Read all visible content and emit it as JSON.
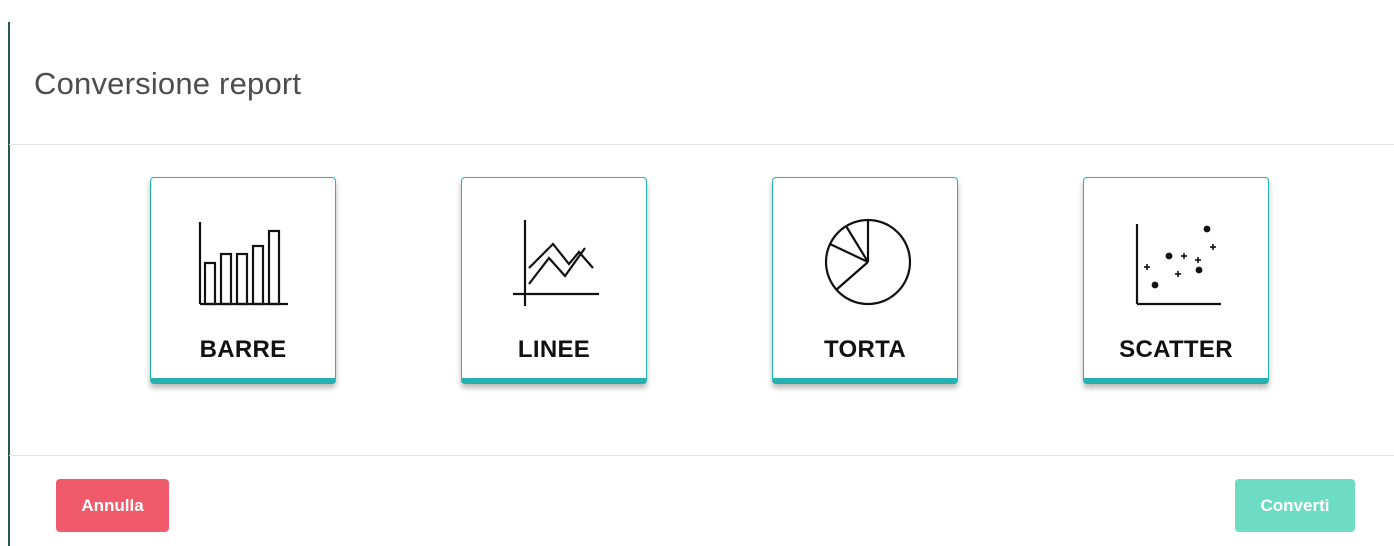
{
  "dialog": {
    "title": "Conversione report"
  },
  "chart_types": [
    {
      "key": "bar",
      "label": "BARRE",
      "icon": "bar-chart-icon"
    },
    {
      "key": "line",
      "label": "LINEE",
      "icon": "line-chart-icon"
    },
    {
      "key": "pie",
      "label": "TORTA",
      "icon": "pie-chart-icon"
    },
    {
      "key": "scatter",
      "label": "SCATTER",
      "icon": "scatter-chart-icon"
    }
  ],
  "footer": {
    "cancel_label": "Annulla",
    "convert_label": "Converti"
  },
  "colors": {
    "accent": "#27b0b0",
    "cancel": "#f05a6a",
    "convert": "#6edbc3"
  }
}
